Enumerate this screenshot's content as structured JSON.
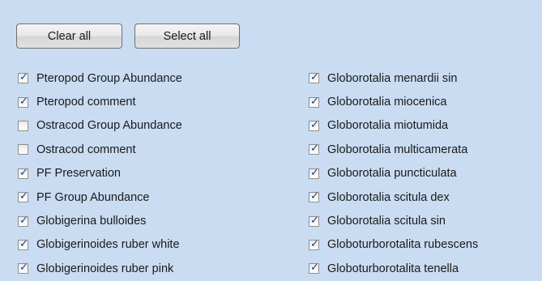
{
  "buttons": {
    "clear_all": "Clear all",
    "select_all": "Select all"
  },
  "checkmark_glyph": "✓",
  "left_items": [
    {
      "label": "Pteropod Group Abundance",
      "checked": true
    },
    {
      "label": "Pteropod comment",
      "checked": true
    },
    {
      "label": "Ostracod Group Abundance",
      "checked": false
    },
    {
      "label": "Ostracod comment",
      "checked": false
    },
    {
      "label": "PF Preservation",
      "checked": true
    },
    {
      "label": "PF Group Abundance",
      "checked": true
    },
    {
      "label": "Globigerina bulloides",
      "checked": true
    },
    {
      "label": "Globigerinoides ruber  white",
      "checked": true
    },
    {
      "label": "Globigerinoides ruber  pink",
      "checked": true
    }
  ],
  "right_items": [
    {
      "label": "Globorotalia menardii  sin",
      "checked": true
    },
    {
      "label": "Globorotalia miocenica",
      "checked": true
    },
    {
      "label": "Globorotalia miotumida",
      "checked": true
    },
    {
      "label": "Globorotalia multicamerata",
      "checked": true
    },
    {
      "label": "Globorotalia puncticulata",
      "checked": true
    },
    {
      "label": "Globorotalia scitula  dex",
      "checked": true
    },
    {
      "label": "Globorotalia scitula  sin",
      "checked": true
    },
    {
      "label": "Globoturborotalita rubescens",
      "checked": true
    },
    {
      "label": "Globoturborotalita tenella",
      "checked": true
    }
  ]
}
